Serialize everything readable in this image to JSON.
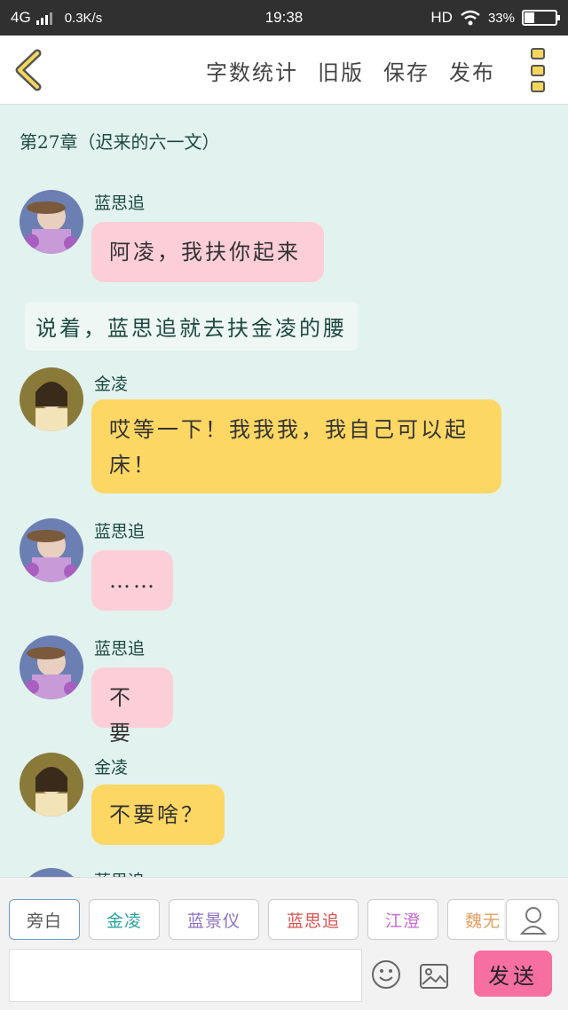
{
  "status": {
    "network": "4G",
    "speed": "0.3K/s",
    "time": "19:38",
    "hd": "HD",
    "battery_text": "33%",
    "battery_level": 0.33
  },
  "toolbar": {
    "actions": [
      "字数统计",
      "旧版",
      "保存",
      "发布"
    ]
  },
  "chapter_title": "第27章（迟来的六一文）",
  "messages": [
    {
      "type": "dialogue",
      "speaker": "蓝思追",
      "text": "阿凌，我扶你起来",
      "color": "pink"
    },
    {
      "type": "narration",
      "text": "说着，蓝思追就去扶金凌的腰"
    },
    {
      "type": "dialogue",
      "speaker": "金凌",
      "text": "哎等一下！我我我，我自己可以起床！",
      "color": "yellow"
    },
    {
      "type": "dialogue",
      "speaker": "蓝思追",
      "text": "……",
      "color": "pink"
    },
    {
      "type": "dialogue",
      "speaker": "蓝思追",
      "text": "不要",
      "color": "pink"
    },
    {
      "type": "dialogue",
      "speaker": "金凌",
      "text": "不要啥？",
      "color": "yellow"
    },
    {
      "type": "dialogue",
      "speaker": "蓝思追",
      "text": "",
      "color": "pink"
    }
  ],
  "characters": [
    {
      "label": "旁白",
      "color": "#555555"
    },
    {
      "label": "金凌",
      "color": "#2aa2a0"
    },
    {
      "label": "蓝景仪",
      "color": "#8b6fc4"
    },
    {
      "label": "蓝思追",
      "color": "#d9534f"
    },
    {
      "label": "江澄",
      "color": "#c86ad6"
    },
    {
      "label": "魏无",
      "color": "#e0a060"
    }
  ],
  "composer": {
    "input_value": "",
    "send_label": "发送"
  },
  "icons": {
    "back": "back-arrow-icon",
    "more": "more-menu-icon",
    "user": "user-icon",
    "emoji": "emoji-icon",
    "image": "image-icon"
  }
}
